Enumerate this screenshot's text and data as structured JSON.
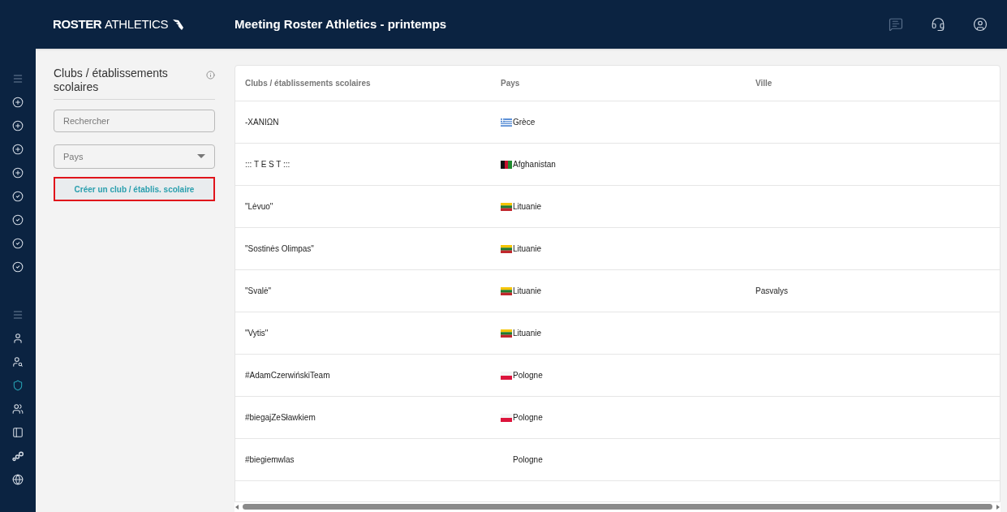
{
  "header": {
    "brand_bold": "ROSTER",
    "brand_light": "ATHLETICS",
    "title": "Meeting Roster Athletics - printemps"
  },
  "nav": {
    "groups": [
      [
        {
          "selected": false
        },
        {
          "selected": false
        },
        {
          "selected": false
        },
        {
          "selected": false
        },
        {
          "selected": false
        },
        {
          "selected": false
        },
        {
          "selected": false
        },
        {
          "selected": false
        },
        {
          "selected": false
        }
      ],
      [
        {
          "selected": false
        },
        {
          "selected": false
        },
        {
          "selected": false
        },
        {
          "selected": true
        },
        {
          "selected": false
        },
        {
          "selected": false
        },
        {
          "selected": false
        },
        {
          "selected": false
        }
      ]
    ]
  },
  "panel": {
    "title": "Clubs / établissements scolaires",
    "search": {
      "placeholder": "Rechercher"
    },
    "country": {
      "placeholder": "Pays"
    },
    "create_button": "Créer un club / établis. scolaire"
  },
  "table": {
    "columns": [
      "Clubs / établissements scolaires",
      "Pays",
      "Ville"
    ],
    "rows": [
      {
        "club": "-XANIΩN",
        "kind": "greece",
        "country": "Grèce"
      },
      {
        "club": "::: T E S T :::",
        "kind": "afghanistan",
        "country": "Afghanistan"
      },
      {
        "club": "\"Lėvuo\"",
        "kind": "lithuania",
        "country": "Lituanie"
      },
      {
        "club": "\"Sostinės Olimpas\"",
        "kind": "lithuania",
        "country": "Lituanie"
      },
      {
        "club": "\"Svalė\"",
        "kind": "lithuania",
        "country": "Lituanie",
        "city": "Pasvalys"
      },
      {
        "club": "\"Vytis\"",
        "kind": "lithuania",
        "country": "Lituanie"
      },
      {
        "club": "#AdamCzerwińskiTeam",
        "kind": "poland",
        "country": "Pologne"
      },
      {
        "club": "#biegajZeSławkiem",
        "kind": "poland",
        "country": "Pologne"
      },
      {
        "club": "#biegiemwlas",
        "kind": "blank",
        "country": "Pologne"
      }
    ]
  }
}
